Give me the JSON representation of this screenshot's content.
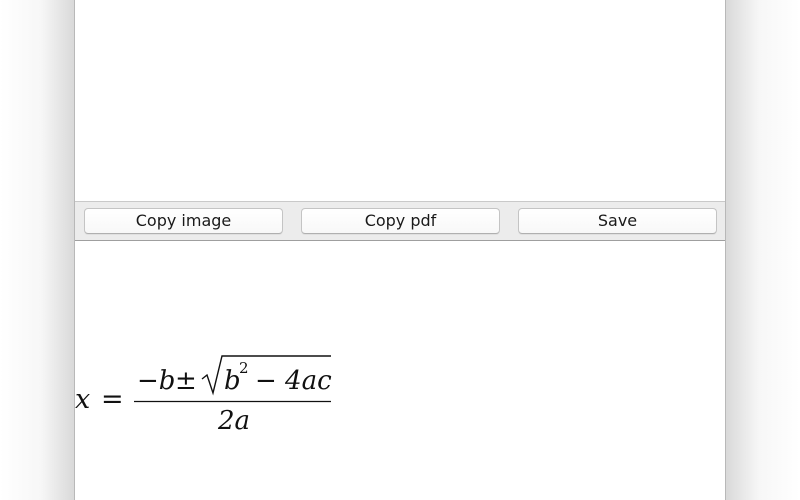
{
  "toolbar": {
    "copy_image_label": "Copy image",
    "copy_pdf_label": "Copy pdf",
    "save_label": "Save"
  },
  "preview": {
    "formula": {
      "lhs_variable": "x",
      "equals": "=",
      "numerator_minus_b": "−b",
      "plus_minus": "±",
      "radicand_b": "b",
      "radicand_exponent": "2",
      "radicand_rest": "− 4ac",
      "denominator": "2a"
    }
  }
}
